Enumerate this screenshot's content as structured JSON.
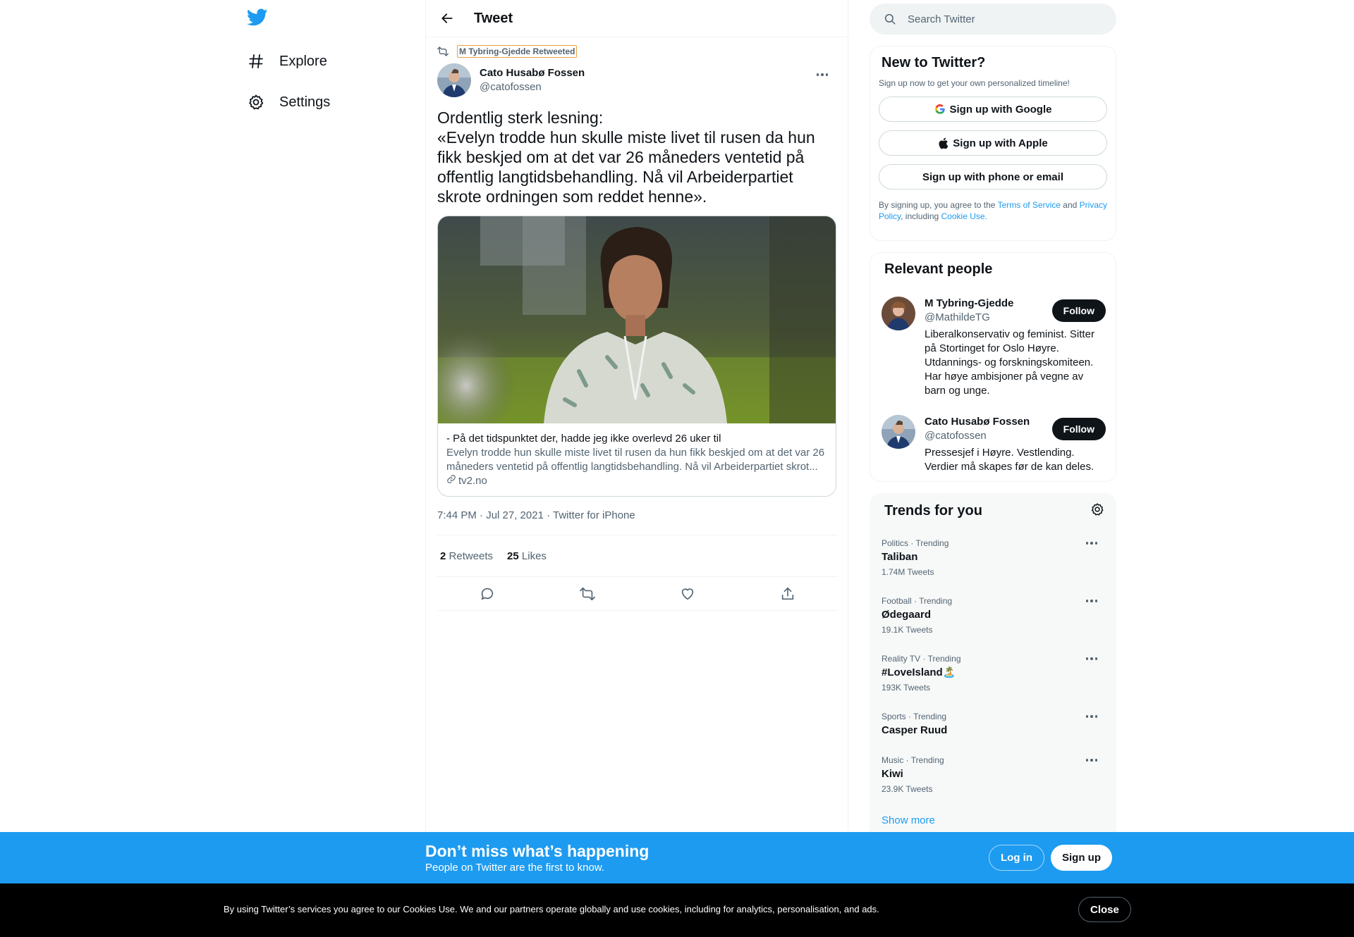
{
  "nav": {
    "logo": "twitter-bird-icon",
    "items": [
      {
        "label": "Explore",
        "icon": "hashtag-icon"
      },
      {
        "label": "Settings",
        "icon": "gear-icon"
      }
    ]
  },
  "header": {
    "title": "Tweet"
  },
  "tweet": {
    "retweeted_by": "M Tybring-Gjedde Retweeted",
    "author_name": "Cato Husabø Fossen",
    "author_handle": "@catofossen",
    "text": "Ordentlig sterk lesning:\n«Evelyn trodde hun skulle miste livet til rusen da hun fikk beskjed om at det var 26 måneders ventetid på offentlig langtidsbehandling. Nå vil Arbeiderpartiet skrote ordningen som reddet henne».",
    "card": {
      "title": "- På det tidspunktet der, hadde jeg ikke overlevd 26 uker til",
      "description": "Evelyn trodde hun skulle miste livet til rusen da hun fikk beskjed om at det var 26 måneders ventetid på offentlig langtidsbehandling. Nå vil Arbeiderpartiet skrot...",
      "domain": "tv2.no"
    },
    "time": "7:44 PM · Jul 27, 2021",
    "source": "Twitter for iPhone",
    "retweets_count": "2",
    "retweets_label": "Retweets",
    "likes_count": "25",
    "likes_label": "Likes"
  },
  "search": {
    "placeholder": "Search Twitter"
  },
  "new_to_twitter": {
    "title": "New to Twitter?",
    "subtitle": "Sign up now to get your own personalized timeline!",
    "google_label": "Sign up with Google",
    "apple_label": "Sign up with Apple",
    "phone_label": "Sign up with phone or email",
    "legal_prefix": "By signing up, you agree to the",
    "terms_link": "Terms of Service",
    "legal_and": "and",
    "privacy_link": "Privacy Policy",
    "legal_including": ", including",
    "cookie_link": "Cookie Use."
  },
  "relevant_people": {
    "title": "Relevant people",
    "people": [
      {
        "name": "M Tybring-Gjedde",
        "handle": "@MathildeTG",
        "bio": "Liberalkonservativ og feminist. Sitter på Stortinget for Oslo Høyre. Utdannings- og forskningskomiteen. Har høye ambisjoner på vegne av barn og unge.",
        "follow_label": "Follow"
      },
      {
        "name": "Cato Husabø Fossen",
        "handle": "@catofossen",
        "bio": "Pressesjef i Høyre. Vestlending. Verdier må skapes før de kan deles.",
        "follow_label": "Follow"
      }
    ]
  },
  "trends": {
    "title": "Trends for you",
    "items": [
      {
        "category": "Politics · Trending",
        "name": "Taliban",
        "count": "1.74M Tweets"
      },
      {
        "category": "Football · Trending",
        "name": "Ødegaard",
        "count": "19.1K Tweets"
      },
      {
        "category": "Reality TV · Trending",
        "name": "#LoveIsland🏝️",
        "count": "193K Tweets"
      },
      {
        "category": "Sports · Trending",
        "name": "Casper Ruud",
        "count": ""
      },
      {
        "category": "Music · Trending",
        "name": "Kiwi",
        "count": "23.9K Tweets"
      }
    ],
    "show_more": "Show more"
  },
  "banner": {
    "title": "Don’t miss what’s happening",
    "subtitle": "People on Twitter are the first to know.",
    "login_label": "Log in",
    "signup_label": "Sign up"
  },
  "cookie": {
    "text": "By using Twitter’s services you agree to our Cookies Use. We and our partners operate globally and use cookies, including for analytics, personalisation, and ads.",
    "close_label": "Close"
  },
  "colors": {
    "accent": "#1d9bf0",
    "text": "#0f1419",
    "muted": "#536471",
    "border": "#eff3f4"
  }
}
